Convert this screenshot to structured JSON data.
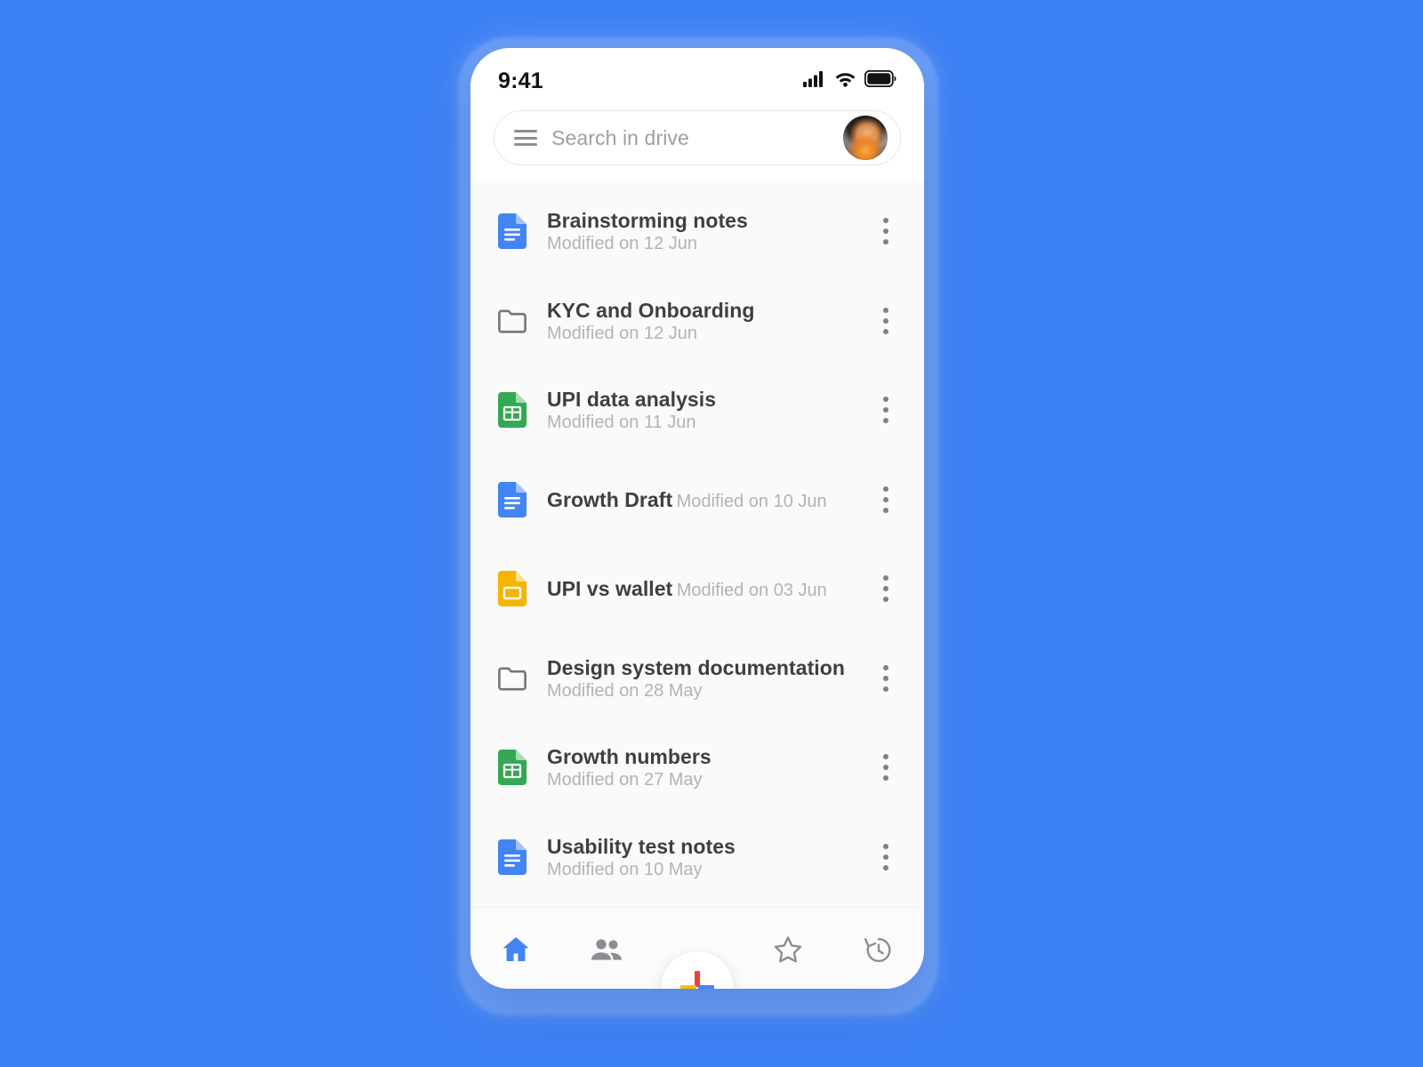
{
  "theme": {
    "background_color": "#3d82f5",
    "phone_surface": "#ffffff",
    "list_surface": "#fafafa",
    "accent_color": "#4285f4",
    "google_red": "#ea4335",
    "google_yellow": "#fbbc04",
    "google_green": "#34a853",
    "google_blue": "#4285f4",
    "docs_blue": "#4285f4",
    "sheets_green": "#34a853",
    "slides_yellow": "#f4b400",
    "folder_gray": "#757575",
    "muted_text": "#b0b3b8",
    "title_text": "#3c4043"
  },
  "status_bar": {
    "time": "9:41",
    "icons": [
      "cellular-signal-icon",
      "wifi-icon",
      "battery-icon"
    ]
  },
  "search": {
    "menu_icon": "hamburger-menu-icon",
    "placeholder": "Search in drive",
    "value": "",
    "avatar_name": "account-avatar"
  },
  "files": [
    {
      "name": "Brainstorming notes",
      "modified": "Modified on 12 Jun",
      "icon": "google-docs-icon",
      "type": "doc"
    },
    {
      "name": "KYC and Onboarding",
      "modified": "Modified on 12 Jun",
      "icon": "folder-icon",
      "type": "folder"
    },
    {
      "name": "UPI data analysis",
      "modified": "Modified on 11 Jun",
      "icon": "google-sheets-icon",
      "type": "sheet"
    },
    {
      "name": "Growth Draft",
      "modified": "Modified on 10 Jun",
      "icon": "google-docs-icon",
      "type": "doc"
    },
    {
      "name": "UPI vs wallet",
      "modified": "Modified on 03 Jun",
      "icon": "google-slides-icon",
      "type": "slide"
    },
    {
      "name": "Design system documentation",
      "modified": "Modified on 28 May",
      "icon": "folder-icon",
      "type": "folder"
    },
    {
      "name": "Growth numbers",
      "modified": "Modified on 27 May",
      "icon": "google-sheets-icon",
      "type": "sheet"
    },
    {
      "name": "Usability test notes",
      "modified": "Modified on 10 May",
      "icon": "google-docs-icon",
      "type": "doc"
    }
  ],
  "row_menu": {
    "icon": "overflow-menu-icon",
    "label": "More options"
  },
  "fab": {
    "icon": "plus-icon",
    "label": "New"
  },
  "bottom_nav": {
    "items": [
      {
        "icon": "home-icon",
        "label": "Home",
        "active": true
      },
      {
        "icon": "shared-icon",
        "label": "Shared",
        "active": false
      },
      {
        "icon": "starred-icon",
        "label": "Starred",
        "active": false
      },
      {
        "icon": "recent-icon",
        "label": "Recent",
        "active": false
      }
    ]
  }
}
